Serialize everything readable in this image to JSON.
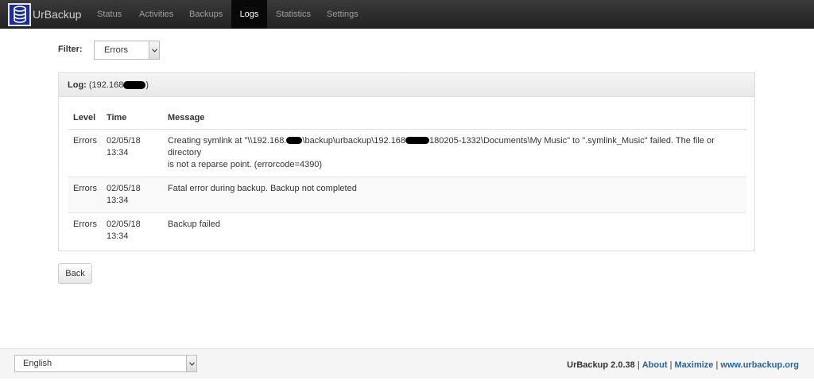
{
  "navbar": {
    "brand": "UrBackup",
    "items": [
      "Status",
      "Activities",
      "Backups",
      "Logs",
      "Statistics",
      "Settings"
    ],
    "active": "Logs"
  },
  "filter": {
    "label": "Filter:",
    "selected": "Errors"
  },
  "log": {
    "label": "Log:",
    "client": "(192.168",
    "client_end": ")",
    "columns": [
      "Level",
      "Time",
      "Message"
    ],
    "rows": [
      {
        "level": "Errors",
        "date": "02/05/18",
        "time": "13:34",
        "msg_a": "Creating symlink at \"\\\\192.168.",
        "msg_b": "\\backup\\urbackup\\192.168",
        "msg_c": "180205-1332\\Documents\\My Music\" to \".symlink_Music\" failed. The file or directory",
        "msg_d": "is not a reparse point. (errorcode=4390)"
      },
      {
        "level": "Errors",
        "date": "02/05/18",
        "time": "13:34",
        "msg_a": "Fatal error during backup. Backup not completed"
      },
      {
        "level": "Errors",
        "date": "02/05/18",
        "time": "13:34",
        "msg_a": "Backup failed"
      }
    ]
  },
  "back_label": "Back",
  "footer": {
    "language": "English",
    "version": "UrBackup 2.0.38",
    "sep": "|",
    "about": "About",
    "maximize": "Maximize",
    "website": "www.urbackup.org"
  }
}
